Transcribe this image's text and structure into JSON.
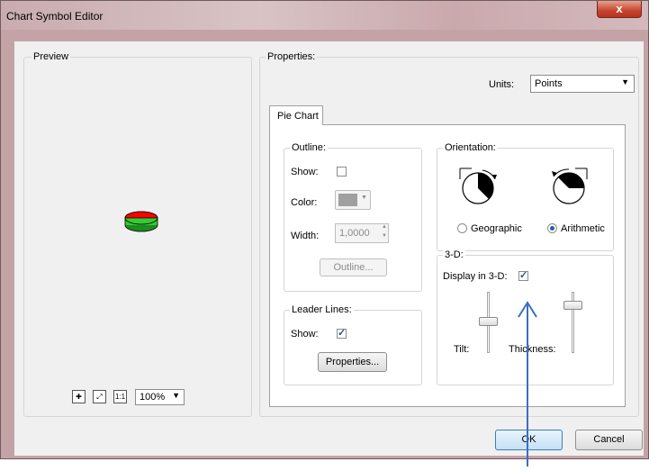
{
  "window": {
    "title": "Chart Symbol Editor",
    "close_label": "x"
  },
  "preview": {
    "label": "Preview",
    "zoom_value": "100%",
    "actual_size_label": "1:1"
  },
  "properties": {
    "label": "Properties:",
    "units_label": "Units:",
    "units_value": "Points",
    "tab_pie_chart": "Pie Chart"
  },
  "outline": {
    "label": "Outline:",
    "show_label": "Show:",
    "show_checked": false,
    "color_label": "Color:",
    "color_value": "#a0a0a0",
    "width_label": "Width:",
    "width_value": "1,0000",
    "button_label": "Outline..."
  },
  "leader_lines": {
    "label": "Leader Lines:",
    "show_label": "Show:",
    "show_checked": true,
    "button_label": "Properties..."
  },
  "orientation": {
    "label": "Orientation:",
    "geographic_label": "Geographic",
    "arithmetic_label": "Arithmetic",
    "selected": "Arithmetic"
  },
  "three_d": {
    "label": "3-D:",
    "display_label": "Display in 3-D:",
    "display_checked": true,
    "tilt_label": "Tilt:",
    "thickness_label": "Thickness:"
  },
  "footer": {
    "ok_label": "OK",
    "cancel_label": "Cancel"
  },
  "colors": {
    "pie_red": "#ff0000",
    "pie_green": "#33cc33",
    "arrow": "#3a6fbf"
  }
}
